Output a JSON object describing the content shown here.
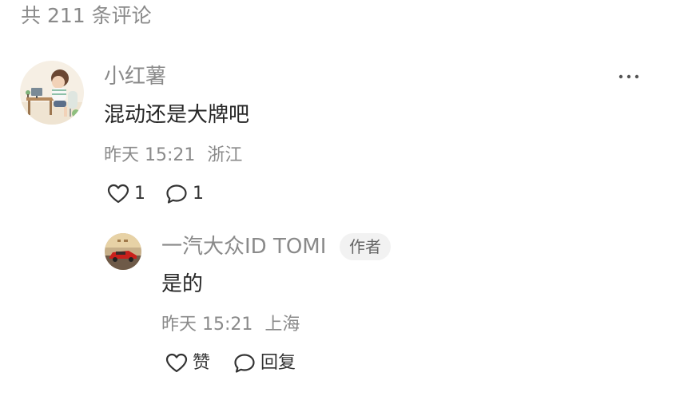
{
  "header": {
    "count_text": "共 211 条评论"
  },
  "comment": {
    "username": "小红薯",
    "avatar_icon": "cartoon-girl-avatar",
    "content": "混动还是大牌吧",
    "time": "昨天 15:21",
    "location": "浙江",
    "like_count": "1",
    "reply_count": "1",
    "more_icon": "more-dots-icon"
  },
  "reply": {
    "username": "一汽大众ID TOMI",
    "badge": "作者",
    "avatar_icon": "red-car-avatar",
    "content": "是的",
    "time": "昨天 15:21",
    "location": "上海",
    "like_label": "赞",
    "reply_label": "回复"
  },
  "colors": {
    "secondary_text": "#8a8a8a",
    "primary_text": "#262626",
    "badge_bg": "#f2f2f2"
  }
}
